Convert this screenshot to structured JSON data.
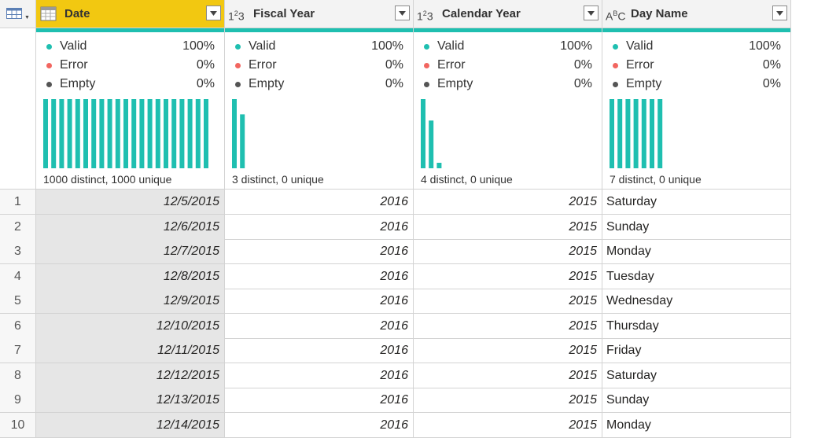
{
  "colors": {
    "accent": "#1fbfb0",
    "selected_header": "#f2c811",
    "error": "#f26660",
    "empty": "#555555"
  },
  "columns": [
    {
      "type_icon": "calendar-icon",
      "name": "Date",
      "valid": "100%",
      "error": "0%",
      "empty": "0%",
      "stats": "1000 distinct, 1000 unique",
      "hist": [
        1,
        1,
        1,
        1,
        1,
        1,
        1,
        1,
        1,
        1,
        1,
        1,
        1,
        1,
        1,
        1,
        1,
        1,
        1,
        1,
        1
      ]
    },
    {
      "type_icon": "whole-number-icon",
      "name": "Fiscal Year",
      "valid": "100%",
      "error": "0%",
      "empty": "0%",
      "stats": "3 distinct, 0 unique",
      "hist": [
        1,
        0.78
      ]
    },
    {
      "type_icon": "whole-number-icon",
      "name": "Calendar Year",
      "valid": "100%",
      "error": "0%",
      "empty": "0%",
      "stats": "4 distinct, 0 unique",
      "hist": [
        1,
        0.69,
        0.08
      ]
    },
    {
      "type_icon": "text-icon",
      "name": "Day Name",
      "valid": "100%",
      "error": "0%",
      "empty": "0%",
      "stats": "7 distinct, 0 unique",
      "hist": [
        1,
        1,
        1,
        1,
        1,
        1,
        1
      ]
    }
  ],
  "labels": {
    "valid": "Valid",
    "error": "Error",
    "empty": "Empty"
  },
  "rows": [
    {
      "n": "1",
      "date": "12/5/2015",
      "fiscal": "2016",
      "cal": "2015",
      "day": "Saturday"
    },
    {
      "n": "2",
      "date": "12/6/2015",
      "fiscal": "2016",
      "cal": "2015",
      "day": "Sunday"
    },
    {
      "n": "3",
      "date": "12/7/2015",
      "fiscal": "2016",
      "cal": "2015",
      "day": "Monday"
    },
    {
      "n": "4",
      "date": "12/8/2015",
      "fiscal": "2016",
      "cal": "2015",
      "day": "Tuesday"
    },
    {
      "n": "5",
      "date": "12/9/2015",
      "fiscal": "2016",
      "cal": "2015",
      "day": "Wednesday"
    },
    {
      "n": "6",
      "date": "12/10/2015",
      "fiscal": "2016",
      "cal": "2015",
      "day": "Thursday"
    },
    {
      "n": "7",
      "date": "12/11/2015",
      "fiscal": "2016",
      "cal": "2015",
      "day": "Friday"
    },
    {
      "n": "8",
      "date": "12/12/2015",
      "fiscal": "2016",
      "cal": "2015",
      "day": "Saturday"
    },
    {
      "n": "9",
      "date": "12/13/2015",
      "fiscal": "2016",
      "cal": "2015",
      "day": "Sunday"
    },
    {
      "n": "10",
      "date": "12/14/2015",
      "fiscal": "2016",
      "cal": "2015",
      "day": "Monday"
    }
  ]
}
